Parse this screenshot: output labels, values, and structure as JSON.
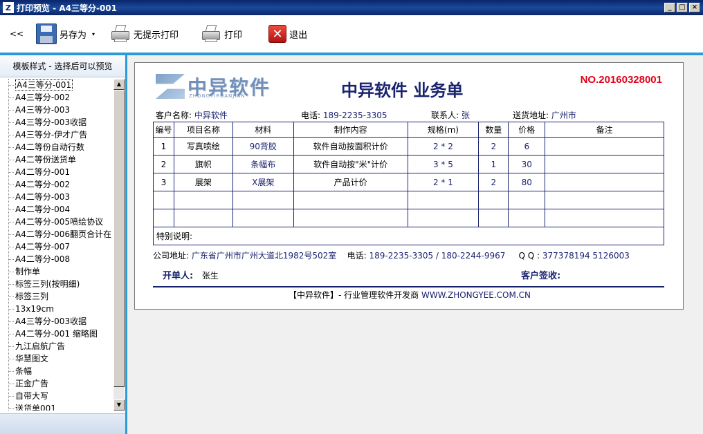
{
  "window": {
    "title": "打印预览 - A4三等分-001",
    "app_icon": "Z",
    "min_icon": "_",
    "max_icon": "□",
    "close_icon": "×"
  },
  "toolbar": {
    "back_label": "<<",
    "save_as_label": "另存为",
    "save_as_arrow": "▾",
    "print_silent_label": "无提示打印",
    "print_label": "打印",
    "exit_label": "退出",
    "exit_glyph": "✕"
  },
  "sidebar": {
    "header": "模板样式 - 选择后可以预览",
    "scroll_up": "▲",
    "scroll_down": "▼",
    "items": [
      "A4三等分-001",
      "A4三等分-002",
      "A4三等分-003",
      "A4三等分-003收据",
      "A4三等分-伊才广告",
      "A4二等份自动行数",
      "A4二等份送货单",
      "A4二等分-001",
      "A4二等分-002",
      "A4二等分-003",
      "A4二等分-004",
      "A4二等分-005喷绘协议",
      "A4二等分-006翻页合计在",
      "A4二等分-007",
      "A4二等分-008",
      "制作单",
      "标签三列(按明细)",
      "标签三列",
      "13x19cm",
      "A4三等分-003收据",
      "A4二等分-001 缩略图",
      "九江启航广告",
      "华慧图文",
      "条幅",
      "正金广告",
      "自带大写",
      "送货单001"
    ]
  },
  "doc": {
    "logo_cn": "中异软件",
    "logo_en": "ZHONGYIRUANJIAN",
    "title": "中异软件  业务单",
    "number": "NO.20160328001",
    "customer_label": "客户名称:",
    "customer": "中异软件",
    "phone_label": "电话:",
    "phone": "189-2235-3305",
    "contact_label": "联系人:",
    "contact": "张",
    "address_label": "送货地址:",
    "address": "广州市",
    "columns": [
      "编号",
      "项目名称",
      "材料",
      "制作内容",
      "规格(m)",
      "数量",
      "价格",
      "备注"
    ],
    "rows": [
      [
        "1",
        "写真喷绘",
        "90背胶",
        "软件自动按面积计价",
        "2 * 2",
        "2",
        "6",
        ""
      ],
      [
        "2",
        "旗帜",
        "条幅布",
        "软件自动按\"米\"计价",
        "3 * 5",
        "1",
        "30",
        ""
      ],
      [
        "3",
        "展架",
        "X展架",
        "产品计价",
        "2 * 1",
        "2",
        "80",
        ""
      ],
      [
        "",
        "",
        "",
        "",
        "",
        "",
        "",
        ""
      ],
      [
        "",
        "",
        "",
        "",
        "",
        "",
        "",
        ""
      ]
    ],
    "special_label": "特别说明:",
    "company_addr_label": "公司地址:",
    "company_addr": "广东省广州市广州大道北1982号502室",
    "company_phone_label": "电话:",
    "company_phone": "189-2235-3305 / 180-2244-9967",
    "qq_label": "Q Q :",
    "qq": "377378194 5126003",
    "issuer_label": "开单人:",
    "issuer": "张生",
    "customer_sign_label": "客户签收:",
    "footer_brand": "【中异软件】- 行业管理软件开发商",
    "footer_url": "WWW.ZHONGYEE.COM.CN"
  }
}
